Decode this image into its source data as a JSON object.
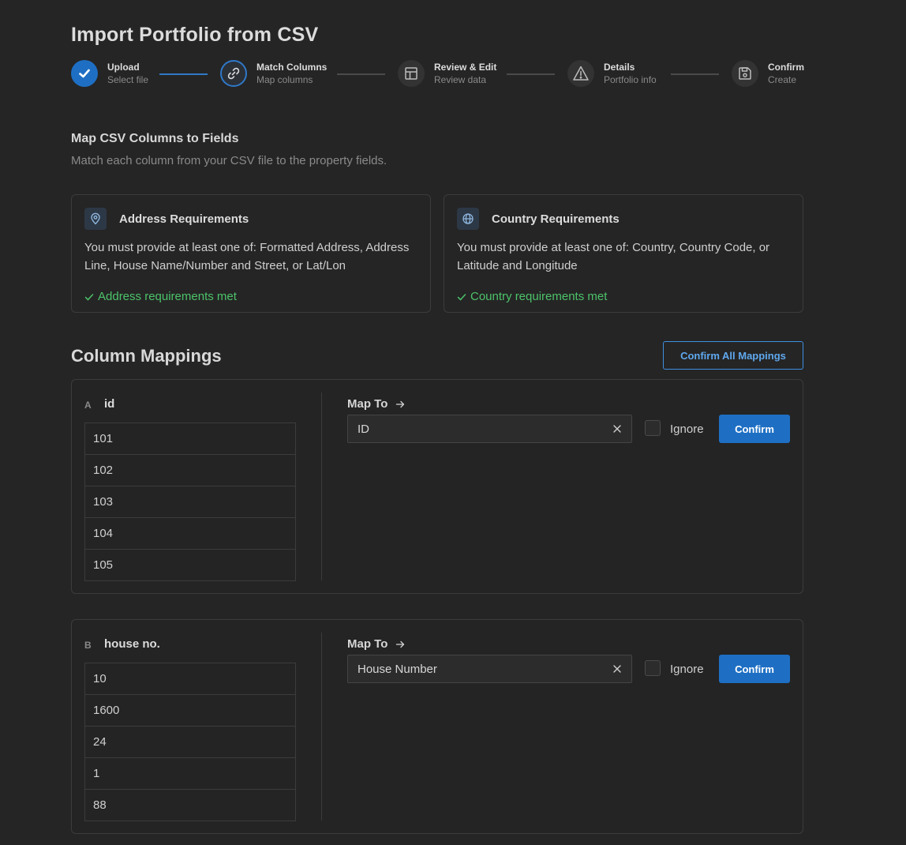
{
  "title": "Import Portfolio from CSV",
  "steps": [
    {
      "label": "Upload",
      "sub": "Select file",
      "icon": "check-icon",
      "state": "done"
    },
    {
      "label": "Match Columns",
      "sub": "Map columns",
      "icon": "link-icon",
      "state": "active"
    },
    {
      "label": "Review & Edit",
      "sub": "Review data",
      "icon": "table-icon",
      "state": "pending"
    },
    {
      "label": "Details",
      "sub": "Portfolio info",
      "icon": "warning-icon",
      "state": "pending"
    },
    {
      "label": "Confirm",
      "sub": "Create",
      "icon": "save-icon",
      "state": "pending"
    }
  ],
  "section": {
    "title": "Map CSV Columns to Fields",
    "subtitle": "Match each column from your CSV file to the property fields."
  },
  "requirements": [
    {
      "icon": "location-pin-icon",
      "title": "Address Requirements",
      "body": "You must provide at least one of: Formatted Address, Address Line, House Name/Number and Street, or Lat/Lon",
      "status": "Address requirements met"
    },
    {
      "icon": "globe-icon",
      "title": "Country Requirements",
      "body": "You must provide at least one of: Country, Country Code, or Latitude and Longitude",
      "status": "Country requirements met"
    }
  ],
  "mappings": {
    "title": "Column Mappings",
    "confirm_all_label": "Confirm All Mappings",
    "map_to_label": "Map To",
    "ignore_label": "Ignore",
    "confirm_label": "Confirm",
    "columns": [
      {
        "letter": "A",
        "name": "id",
        "mapped_to": "ID",
        "samples": [
          "101",
          "102",
          "103",
          "104",
          "105"
        ]
      },
      {
        "letter": "B",
        "name": "house no.",
        "mapped_to": "House Number",
        "samples": [
          "10",
          "1600",
          "24",
          "1",
          "88"
        ]
      }
    ]
  },
  "colors": {
    "background": "#252525",
    "accent": "#1e6fc4",
    "accent_text": "#5fa8ee",
    "success": "#4cc36a"
  }
}
